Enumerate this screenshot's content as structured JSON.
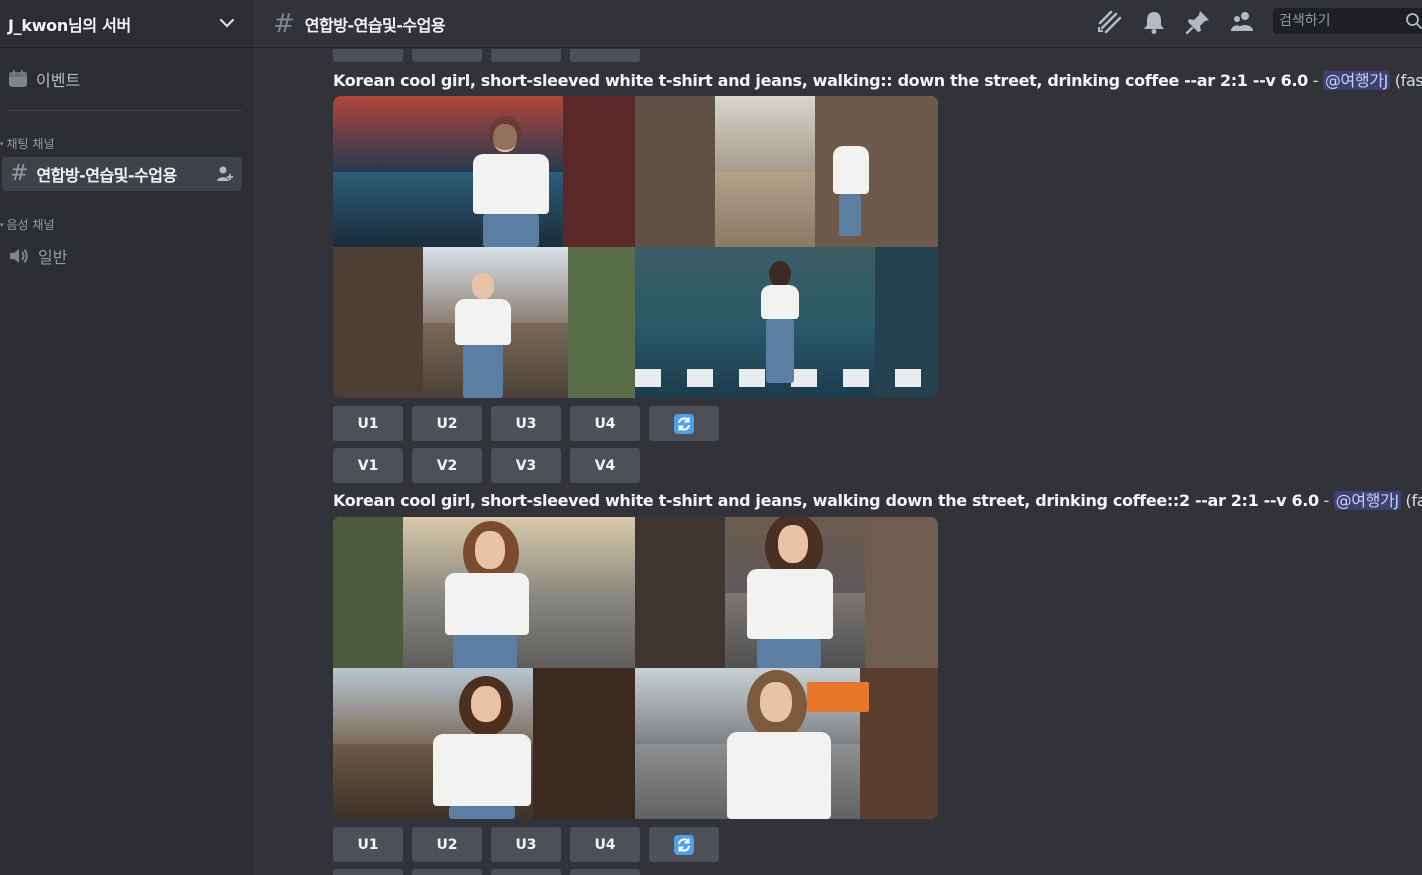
{
  "server": {
    "name": "J_kwon님의 서버"
  },
  "sidebar": {
    "events_label": "이벤트",
    "categories": [
      {
        "label": "채팅 채널"
      },
      {
        "label": "음성 채널"
      }
    ],
    "text_channel": {
      "name": "연합방-연습및-수업용"
    },
    "voice_channel": {
      "name": "일반"
    }
  },
  "topbar": {
    "channel_title": "연합방-연습및-수업용",
    "search_placeholder": "검색하기"
  },
  "messages": [
    {
      "prompt": "Korean cool girl, short-sleeved white t-shirt and jeans, walking:: down the street, drinking coffee --ar 2:1 --v 6.0",
      "separator": " - ",
      "mention": "@여행가J",
      "speed": "(fast)"
    },
    {
      "prompt": "Korean cool girl, short-sleeved white t-shirt and jeans, walking down the street, drinking coffee::2 --ar 2:1 --v 6.0",
      "separator": " - ",
      "mention": "@여행가J",
      "speed": "(fast)"
    }
  ],
  "buttons": {
    "upscale": [
      "U1",
      "U2",
      "U3",
      "U4"
    ],
    "variation": [
      "V1",
      "V2",
      "V3",
      "V4"
    ]
  },
  "colors": {
    "accent_blue": "#4ea1e8",
    "button_bg": "#4e5058",
    "mention_bg": "#3c4270"
  }
}
